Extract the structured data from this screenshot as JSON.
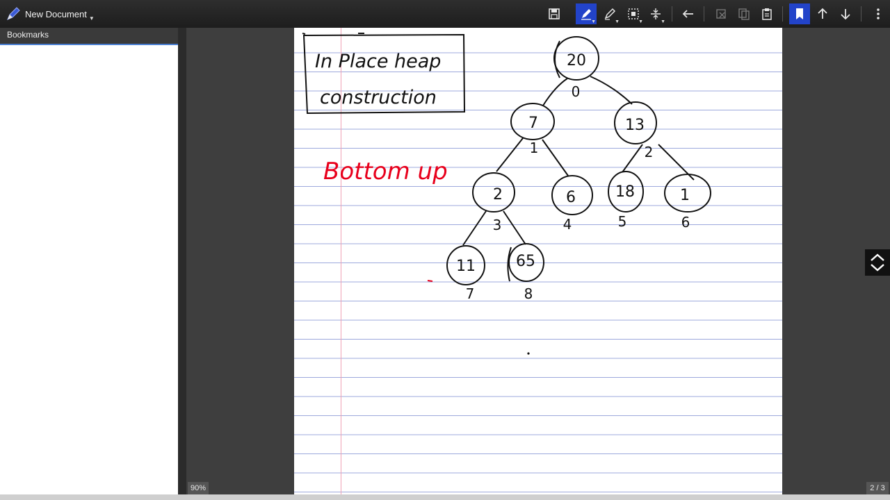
{
  "app": {
    "document_title": "New Document"
  },
  "toolbar": {
    "buttons": [
      {
        "name": "save",
        "icon": "save-icon"
      },
      {
        "name": "pen",
        "icon": "pen-icon",
        "active": true
      },
      {
        "name": "eraser",
        "icon": "eraser-icon"
      },
      {
        "name": "selection",
        "icon": "selection-icon"
      },
      {
        "name": "insert-space",
        "icon": "insert-space-icon"
      },
      {
        "name": "undo",
        "icon": "undo-icon"
      },
      {
        "name": "cut",
        "icon": "cut-icon"
      },
      {
        "name": "copy",
        "icon": "copy-icon"
      },
      {
        "name": "paste",
        "icon": "paste-icon"
      },
      {
        "name": "bookmark",
        "icon": "bookmark-icon",
        "active": true
      },
      {
        "name": "previous",
        "icon": "arrow-up-icon"
      },
      {
        "name": "next",
        "icon": "arrow-down-icon"
      },
      {
        "name": "menu",
        "icon": "more-vertical-icon"
      }
    ],
    "active_color": "#2243c9"
  },
  "sidebar": {
    "title": "Bookmarks"
  },
  "status": {
    "zoom": "90%",
    "page_indicator": "2 / 3"
  },
  "note": {
    "title_line1": "In Place heap",
    "title_line2": "construction",
    "subtitle": "Bottom up",
    "subtitle_color": "#e8001c",
    "tree_nodes": [
      {
        "value": "20",
        "index": "0"
      },
      {
        "value": "7",
        "index": "1"
      },
      {
        "value": "13",
        "index": "2"
      },
      {
        "value": "2",
        "index": "3"
      },
      {
        "value": "6",
        "index": "4"
      },
      {
        "value": "18",
        "index": "5"
      },
      {
        "value": "1",
        "index": "6"
      },
      {
        "value": "11",
        "index": "7"
      },
      {
        "value": "65",
        "index": "8"
      }
    ]
  }
}
